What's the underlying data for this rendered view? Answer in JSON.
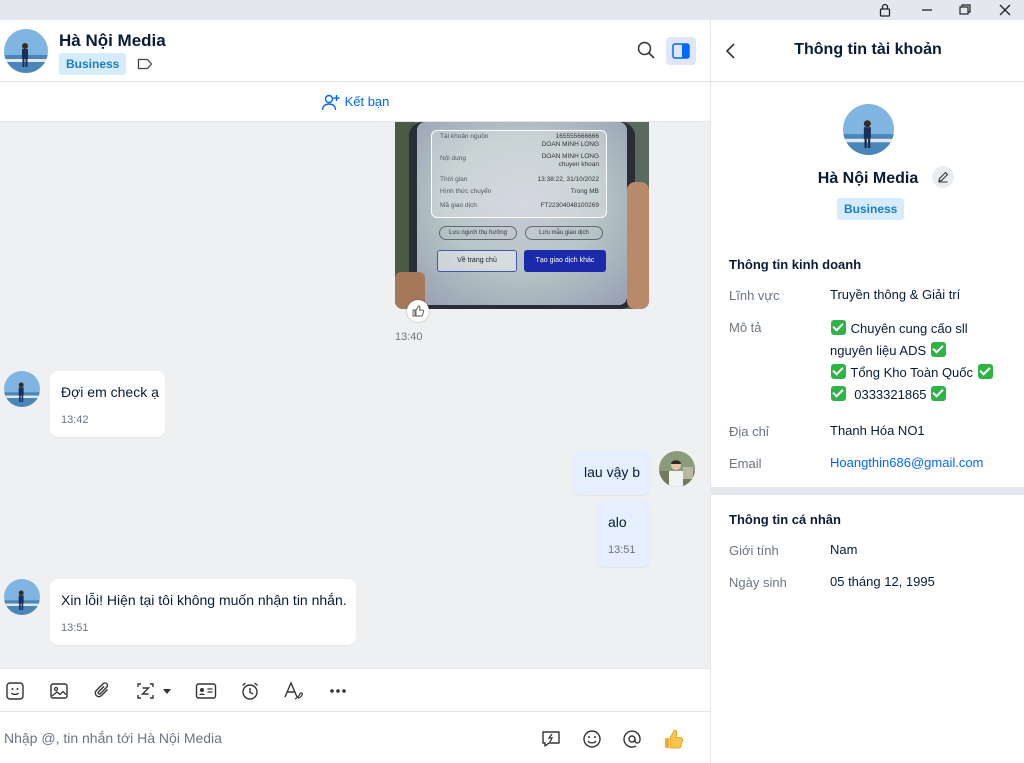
{
  "window": {
    "controls": [
      "lock",
      "minimize",
      "restore",
      "close"
    ]
  },
  "chat": {
    "contact_name": "Hà Nội Media",
    "badge": "Business",
    "add_friend_label": "Kết bạn",
    "photo": {
      "time": "13:40",
      "receipt_rows": [
        {
          "label": "Tài khoản nguồn",
          "value": "165555666666\nDOAN MINH LONG"
        },
        {
          "label": "Nội dung",
          "value": "DOAN MINH LONG\nchuyen khoan"
        },
        {
          "label": "Thời gian",
          "value": "13:38:22, 31/10/2022"
        },
        {
          "label": "Hình thức chuyển",
          "value": "Trong MB"
        },
        {
          "label": "Mã giao dịch",
          "value": "FT22304048100269"
        }
      ],
      "save_payee": "Lưu người thụ hưởng",
      "save_template": "Lưu mẫu giao dịch",
      "home_button": "Về trang chủ",
      "new_transaction_button": "Tạo giao dịch khác"
    },
    "messages": [
      {
        "from": "them",
        "text": "Đợi em check ạ",
        "time": "13:42"
      },
      {
        "from": "me",
        "text": "lau vậy b",
        "time": ""
      },
      {
        "from": "me",
        "text": "alo",
        "time": "13:51"
      },
      {
        "from": "them",
        "text": "Xin lỗi! Hiện tại tôi không muốn nhận tin nhắn.",
        "time": "13:51"
      }
    ],
    "input_placeholder": "Nhập @, tin nhắn tới Hà Nội Media"
  },
  "panel": {
    "title": "Thông tin tài khoản",
    "name": "Hà Nội Media",
    "badge": "Business",
    "business_section": "Thông tin kinh doanh",
    "field_label": "Lĩnh vực",
    "field_value": "Truyền thông & Giải trí",
    "desc_label": "Mô tả",
    "desc_line1": "Chuyên cung cấo sll",
    "desc_line2": "nguyên liệu ADS",
    "desc_line3": "Tổng Kho Toàn Quốc",
    "desc_line4": "0333321865",
    "address_label": "Địa chỉ",
    "address_value": "Thanh Hóa NO1",
    "email_label": "Email",
    "email_value": "Hoangthin686@gmail.com",
    "personal_section": "Thông tin cá nhân",
    "gender_label": "Giới tính",
    "gender_value": "Nam",
    "birthday_label": "Ngày sinh",
    "birthday_value": "05 tháng 12, 1995"
  },
  "colors": {
    "accent": "#0068ff",
    "badge_bg": "#d6ecfa",
    "badge_text": "#1a7fc1",
    "sent_bubble": "#e5efff",
    "chat_bg": "#eef0f1",
    "check": "#2fb344"
  }
}
